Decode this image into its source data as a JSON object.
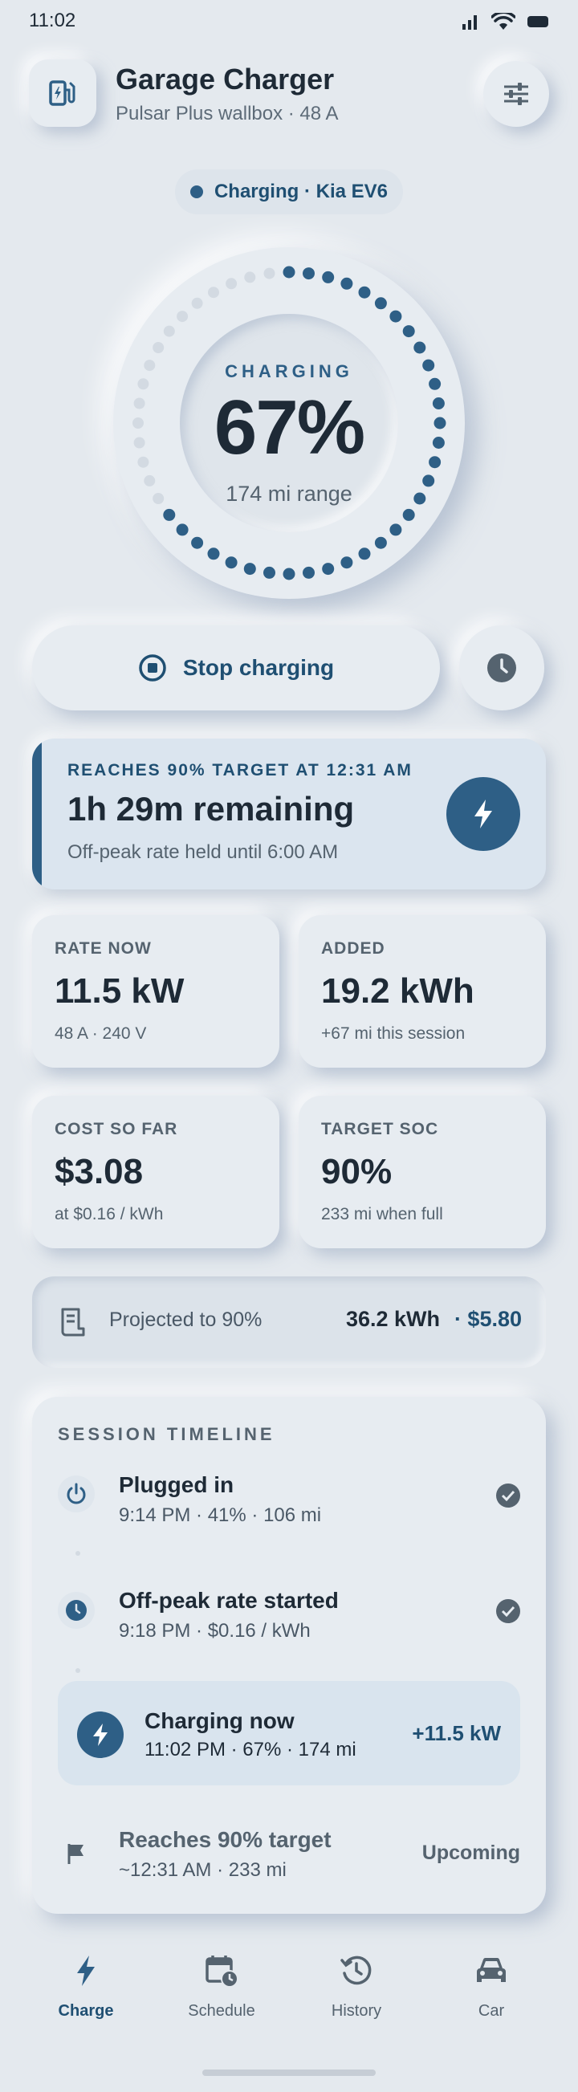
{
  "status_bar": {
    "time": "11:02"
  },
  "header": {
    "title": "Garage Charger",
    "subtitle": "Pulsar Plus wallbox · 48 A"
  },
  "status_pill": {
    "text": "Charging · Kia EV6"
  },
  "gauge": {
    "label": "CHARGING",
    "value": "67%",
    "level": 0.67,
    "range": "174 mi range"
  },
  "actions": {
    "stop_label": "Stop charging"
  },
  "target": {
    "kicker": "REACHES 90% TARGET AT 12:31 AM",
    "remaining": "1h 29m remaining",
    "note": "Off-peak rate held until 6:00 AM"
  },
  "stats": [
    {
      "label": "RATE NOW",
      "value": "11.5 kW",
      "sub": "48 A · 240 V"
    },
    {
      "label": "ADDED",
      "value": "19.2 kWh",
      "sub": "+67 mi this session"
    },
    {
      "label": "COST SO FAR",
      "value": "$3.08",
      "sub": "at $0.16 / kWh"
    },
    {
      "label": "TARGET SOC",
      "value": "90%",
      "sub": "233 mi when full"
    }
  ],
  "projection": {
    "label": "Projected to 90%",
    "energy": "36.2 kWh",
    "cost": "· $5.80"
  },
  "timeline": {
    "heading": "SESSION TIMELINE",
    "events": [
      {
        "title": "Plugged in",
        "detail": "9:14 PM · 41% · 106 mi",
        "state": "done"
      },
      {
        "title": "Off-peak rate started",
        "detail": "9:18 PM · $0.16 / kWh",
        "state": "done"
      },
      {
        "title": "Charging now",
        "detail": "11:02 PM · 67% · 174 mi",
        "state": "active",
        "badge": "+11.5 kW"
      },
      {
        "title": "Reaches 90% target",
        "detail": "~12:31 AM · 233 mi",
        "state": "upcoming",
        "badge": "Upcoming"
      }
    ]
  },
  "nav": {
    "items": [
      {
        "label": "Charge",
        "icon": "bolt-icon",
        "active": true
      },
      {
        "label": "Schedule",
        "icon": "calendar-clock-icon",
        "active": false
      },
      {
        "label": "History",
        "icon": "history-icon",
        "active": false
      },
      {
        "label": "Car",
        "icon": "car-icon",
        "active": false
      }
    ]
  },
  "colors": {
    "background": "#e4e9ee",
    "accent": "#2e5f86",
    "text": "#1e2a36",
    "muted": "#55636f"
  }
}
